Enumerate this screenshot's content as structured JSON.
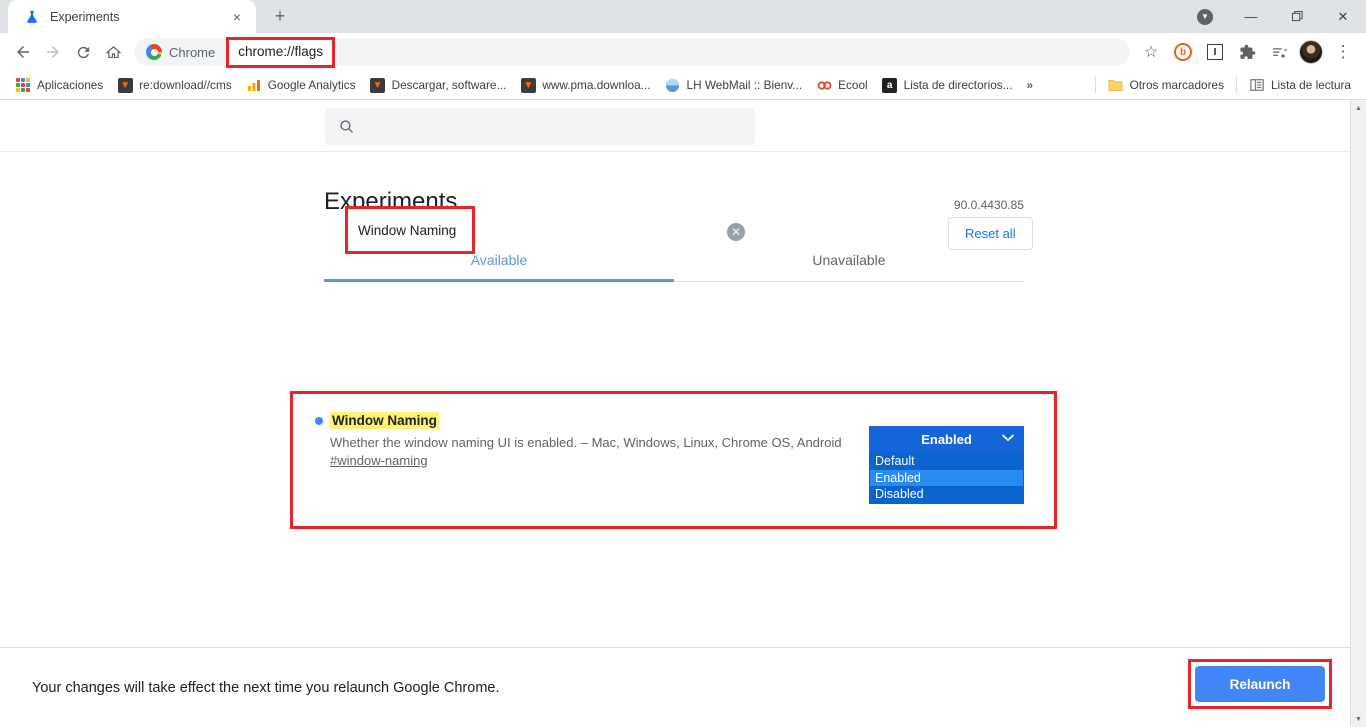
{
  "window": {
    "tab": {
      "title": "Experiments",
      "favicon": "flask-icon",
      "close": "×"
    },
    "newtab_label": "+",
    "controls": {
      "download": "download-indicator",
      "minimize": "—",
      "maximize": "❐",
      "close": "✕"
    }
  },
  "toolbar": {
    "back": "←",
    "forward": "→",
    "reload": "↻",
    "home": "⌂",
    "chip_label": "Chrome",
    "url": "chrome://flags",
    "bookmark_star": "☆",
    "ext_orange": "b",
    "ext_i": "I",
    "ext_puzzle": "puzzle-icon",
    "reading_list": "reading-list-icon",
    "avatar": "profile-avatar",
    "menu": "⋮"
  },
  "bookmarks": {
    "apps_label": "Aplicaciones",
    "items": [
      {
        "label": "re:download//cms",
        "icon_text": "▼",
        "icon_bg": "#3b3b3b",
        "icon_fg": "#ff6a00"
      },
      {
        "label": "Google Analytics",
        "icon_text": "▐",
        "icon_bg": "transparent",
        "icon_fg": "#f9ab00"
      },
      {
        "label": "Descargar, software...",
        "icon_text": "▼",
        "icon_bg": "#3b3b3b",
        "icon_fg": "#ff6a00"
      },
      {
        "label": "www.pma.downloa...",
        "icon_text": "▼",
        "icon_bg": "#3b3b3b",
        "icon_fg": "#ff6a00"
      },
      {
        "label": "LH WebMail :: Bienv...",
        "icon_text": "◐",
        "icon_bg": "transparent",
        "icon_fg": "#4a86c8"
      },
      {
        "label": "Ecool",
        "icon_text": "∞",
        "icon_bg": "transparent",
        "icon_fg": "#e8491d"
      },
      {
        "label": "Lista de directorios...",
        "icon_text": "a",
        "icon_bg": "#202124",
        "icon_fg": "#ffffff"
      }
    ],
    "overflow": "»",
    "other_bookmarks": "Otros marcadores",
    "reading_list": "Lista de lectura"
  },
  "search": {
    "value": "Window Naming",
    "icon": "search-icon",
    "clear_icon": "✕",
    "reset_label": "Reset all"
  },
  "page": {
    "title": "Experiments",
    "version": "90.0.4430.85",
    "tabs": [
      {
        "label": "Available",
        "active": true
      },
      {
        "label": "Unavailable",
        "active": false
      }
    ]
  },
  "flag": {
    "name": "Window Naming",
    "description": "Whether the window naming UI is enabled. – Mac, Windows, Linux, Chrome OS, Android",
    "anchor": "#window-naming",
    "select": {
      "value": "Enabled",
      "chevron": "⌄",
      "options": [
        {
          "label": "Default",
          "selected": false
        },
        {
          "label": "Enabled",
          "selected": true
        },
        {
          "label": "Disabled",
          "selected": false
        }
      ]
    }
  },
  "footer": {
    "message": "Your changes will take effect the next time you relaunch Google Chrome.",
    "relaunch_label": "Relaunch"
  },
  "scrollbar": {
    "up": "▲",
    "down": "▼"
  },
  "colors": {
    "annotation_red": "#e8242a",
    "accent_blue": "#4285f4",
    "select_blue": "#1565d8",
    "highlight_yellow": "#fff275"
  }
}
